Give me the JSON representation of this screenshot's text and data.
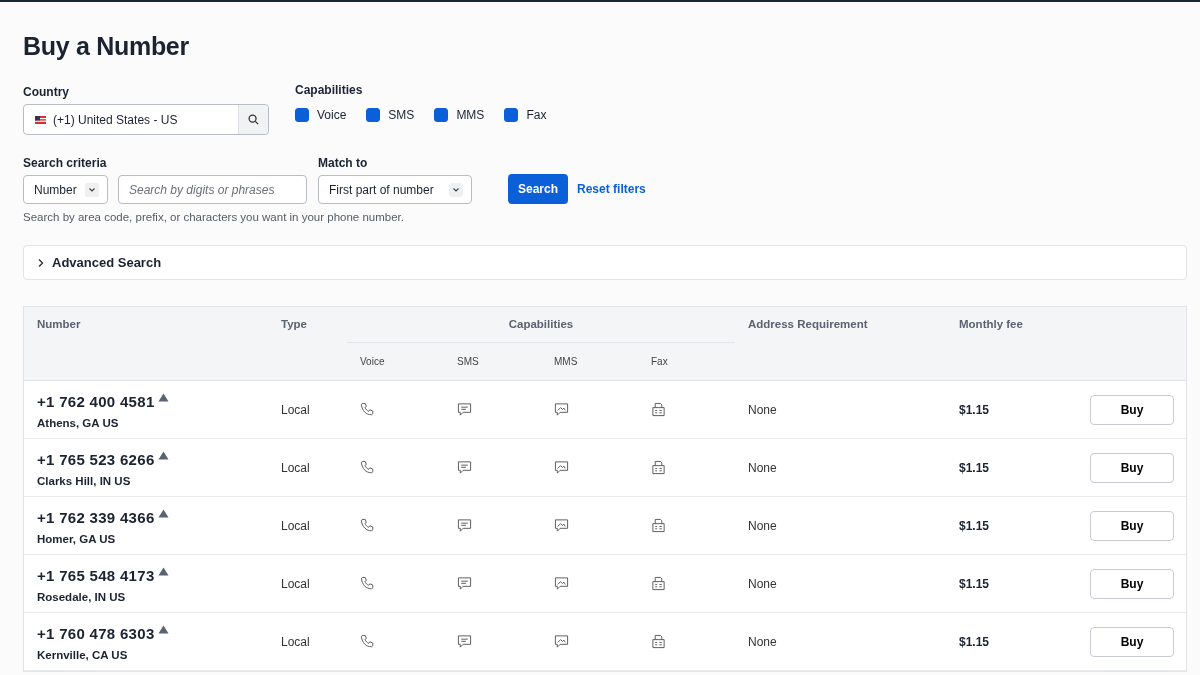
{
  "title": "Buy a Number",
  "country": {
    "label": "Country",
    "value": "(+1) United States - US"
  },
  "capabilities": {
    "label": "Capabilities",
    "options": [
      {
        "label": "Voice",
        "checked": true
      },
      {
        "label": "SMS",
        "checked": true
      },
      {
        "label": "MMS",
        "checked": true
      },
      {
        "label": "Fax",
        "checked": true
      }
    ]
  },
  "search_criteria": {
    "label": "Search criteria",
    "value": "Number",
    "placeholder": "Search by digits or phrases",
    "hint": "Search by area code, prefix, or characters you want in your phone number."
  },
  "match_to": {
    "label": "Match to",
    "value": "First part of number"
  },
  "search_button": "Search",
  "reset_link": "Reset filters",
  "advanced_search": {
    "label": "Advanced Search",
    "expanded": false
  },
  "table": {
    "columns": [
      "Number",
      "Type",
      "Capabilities",
      "Address Requirement",
      "Monthly fee"
    ],
    "capability_columns": [
      "Voice",
      "SMS",
      "MMS",
      "Fax"
    ],
    "rows": [
      {
        "number": "+1 762 400 4581",
        "location": "Athens, GA US",
        "type": "Local",
        "voice": true,
        "sms": true,
        "mms": true,
        "fax": true,
        "address": "None",
        "fee": "$1.15",
        "action": "Buy"
      },
      {
        "number": "+1 765 523 6266",
        "location": "Clarks Hill, IN US",
        "type": "Local",
        "voice": true,
        "sms": true,
        "mms": true,
        "fax": true,
        "address": "None",
        "fee": "$1.15",
        "action": "Buy"
      },
      {
        "number": "+1 762 339 4366",
        "location": "Homer, GA US",
        "type": "Local",
        "voice": true,
        "sms": true,
        "mms": true,
        "fax": true,
        "address": "None",
        "fee": "$1.15",
        "action": "Buy"
      },
      {
        "number": "+1 765 548 4173",
        "location": "Rosedale, IN US",
        "type": "Local",
        "voice": true,
        "sms": true,
        "mms": true,
        "fax": true,
        "address": "None",
        "fee": "$1.15",
        "action": "Buy"
      },
      {
        "number": "+1 760 478 6303",
        "location": "Kernville, CA US",
        "type": "Local",
        "voice": true,
        "sms": true,
        "mms": true,
        "fax": true,
        "address": "None",
        "fee": "$1.15",
        "action": "Buy"
      }
    ]
  }
}
